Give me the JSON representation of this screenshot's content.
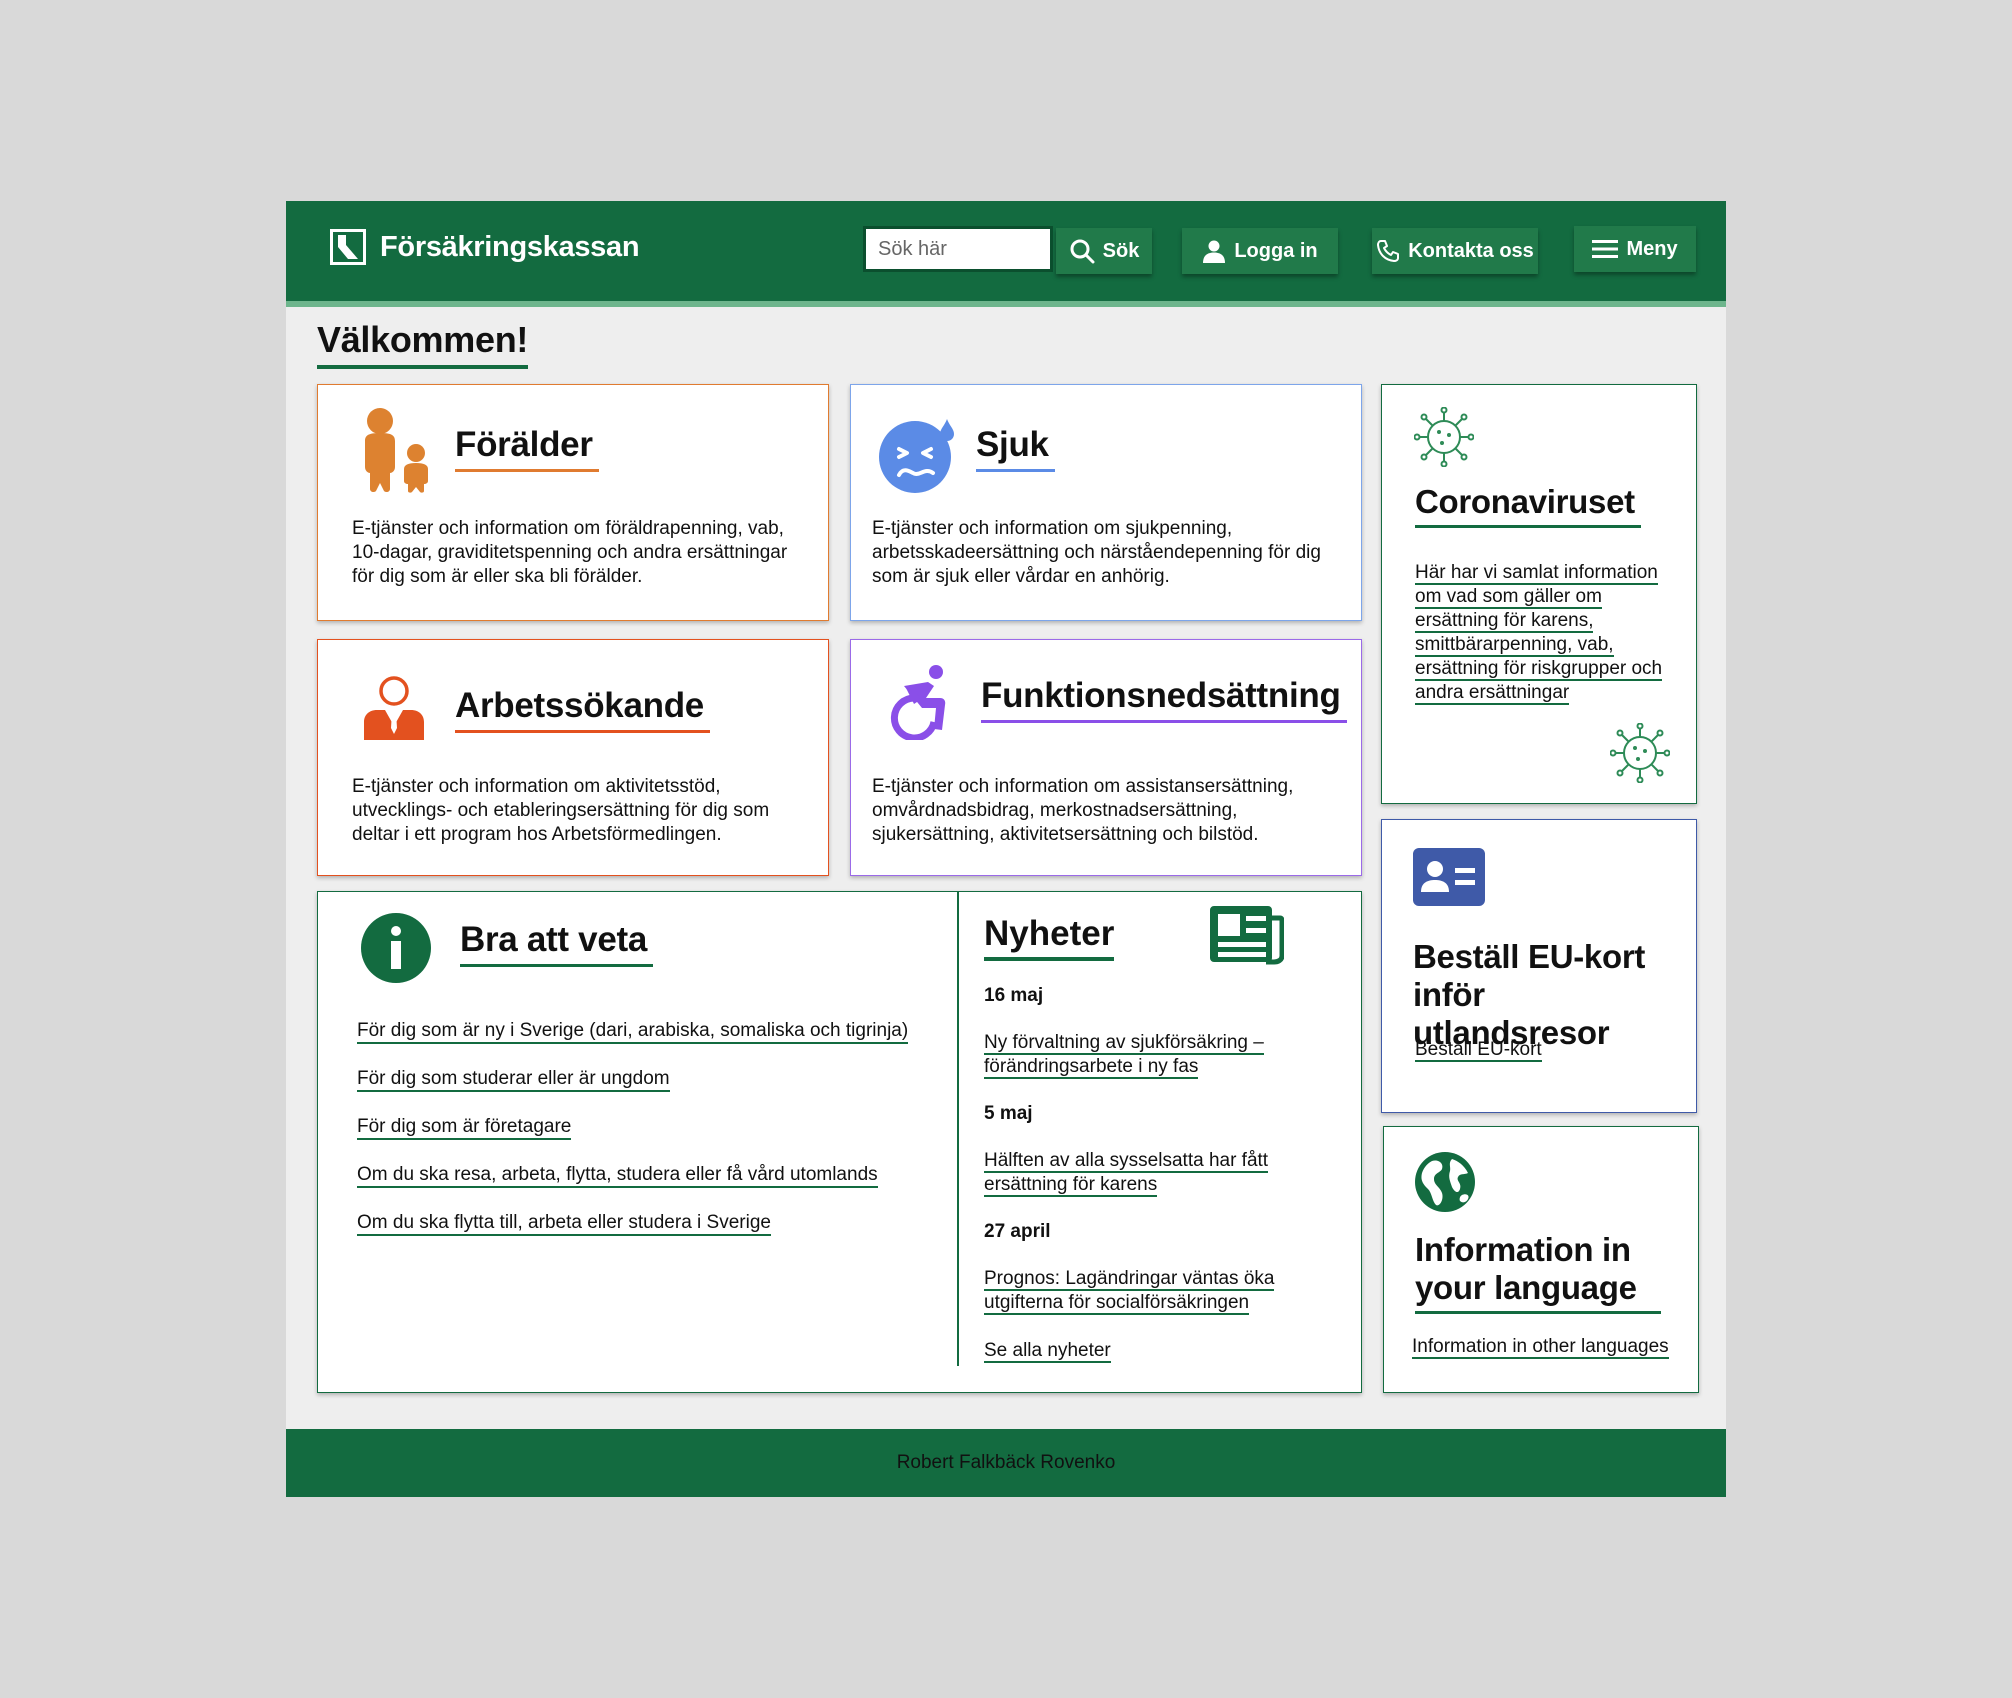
{
  "header": {
    "logo_text": "Försäkringskassan",
    "search_placeholder": "Sök här",
    "search_button": "Sök",
    "login_button": "Logga in",
    "contact_button": "Kontakta oss",
    "menu_button": "Meny"
  },
  "welcome": "Välkommen!",
  "cards": {
    "foralder": {
      "title": "Förälder",
      "desc": "E-tjänster och information om föräldrapenning, vab, 10-dagar, graviditetspenning och andra ersättningar för dig som är eller ska bli förälder.",
      "color": "#e07b30"
    },
    "sjuk": {
      "title": "Sjuk",
      "desc": "E-tjänster och information om sjukpenning, arbetsskadeersättning och närståendepenning för dig som är sjuk eller vårdar en anhörig.",
      "color": "#5b8be6"
    },
    "arbetssokande": {
      "title": "Arbetssökande",
      "desc": "E-tjänster och information om aktivitetsstöd, utvecklings- och etableringsersättning för dig som deltar i ett program hos Arbetsförmedlingen.",
      "color": "#e3511f"
    },
    "funktion": {
      "title": "Funktionsnedsättning",
      "desc": "E-tjänster och information om assistansersättning, omvårdnadsbidrag, merkostnadsersättning, sjukersättning, aktivitetsersättning och bilstöd.",
      "color": "#8a4fe8"
    }
  },
  "bra_att_veta": {
    "title": "Bra att veta",
    "links": [
      "För dig som är ny i Sverige (dari, arabiska, somaliska och tigrinja)",
      "För dig som studerar eller är ungdom",
      "För dig som är företagare",
      "Om du ska resa, arbeta, flytta, studera eller få vård utomlands",
      "Om du ska flytta till, arbeta eller studera i Sverige"
    ]
  },
  "nyheter": {
    "title": "Nyheter",
    "items": [
      {
        "date": "16 maj",
        "text": "Ny förvaltning av sjukförsäkring – förändringsarbete i ny fas"
      },
      {
        "date": "5 maj",
        "text": "Hälften av alla sysselsatta har fått ersättning för karens"
      },
      {
        "date": "27 april",
        "text": "Prognos: Lagändringar väntas öka utgifterna för socialförsäkringen"
      }
    ],
    "all_link": "Se alla nyheter"
  },
  "corona": {
    "title": "Coronaviruset",
    "desc": "Här har vi samlat information om vad som gäller om ersättning för karens, smittbärarpenning, vab, ersättning för riskgrupper och andra ersättningar"
  },
  "eukort": {
    "title": "Beställ EU-kort inför utlandsresor",
    "link": "Beställ EU-kort"
  },
  "language": {
    "title": "Information in your language",
    "link": "Information in other languages"
  },
  "footer": "Robert Falkbäck Rovenko",
  "colors": {
    "brand": "#136b40",
    "accent_light": "#6db58c",
    "eu_blue": "#3f5aa8"
  }
}
